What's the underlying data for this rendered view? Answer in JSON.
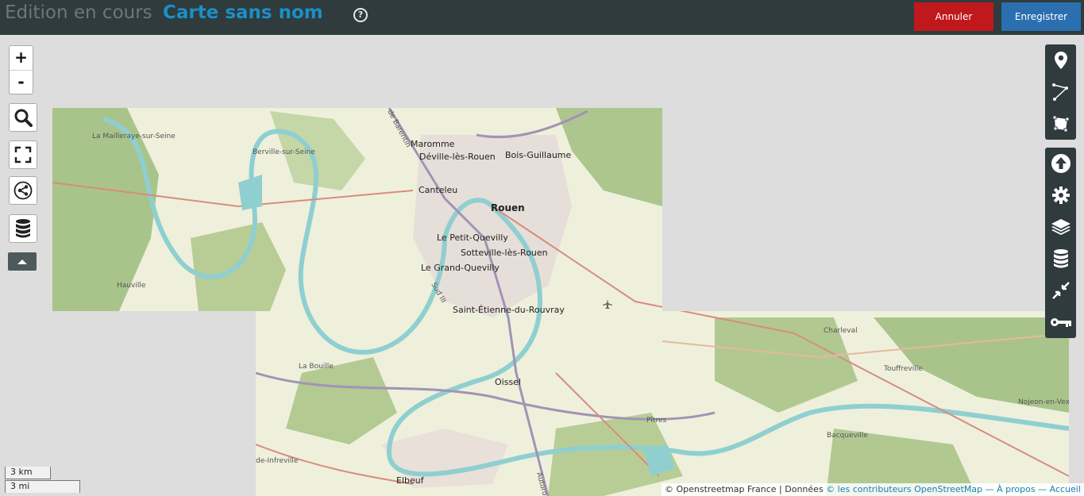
{
  "header": {
    "title_prefix": "Edition en cours",
    "title_name": "Carte sans nom",
    "help_symbol": "?",
    "cancel_label": "Annuler",
    "save_label": "Enregistrer",
    "colors": {
      "bar": "#2f3b3d",
      "title_name": "#1b8fc7",
      "cancel": "#c0181c",
      "save": "#2b6fb1"
    }
  },
  "left_controls": {
    "zoom_in": "+",
    "zoom_out": "-",
    "icons": [
      "search-icon",
      "fullscreen-icon",
      "share-icon",
      "data-layers-icon",
      "collapse-up-icon"
    ]
  },
  "right_toolbar": {
    "draw": [
      "marker-icon",
      "polyline-icon",
      "polygon-icon"
    ],
    "edit": [
      "upload-icon",
      "gear-icon",
      "layers-icon",
      "database-icon",
      "compress-icon",
      "key-icon"
    ]
  },
  "scale": {
    "km": "3 km",
    "mi": "3 mi"
  },
  "attribution": {
    "prefix": "© Openstreetmap France | Données ",
    "contributors": "© les contributeurs OpenStreetMap",
    "about": "— À propos",
    "home": "— Accueil"
  },
  "map_labels": {
    "rouen": "Rouen",
    "maromme": "Maromme",
    "deville": "Déville-lès-Rouen",
    "bois_guillaume": "Bois-Guillaume",
    "canteleu": "Canteleu",
    "petit_quevilly": "Le Petit-Quevilly",
    "sotteville": "Sotteville-lès-Rouen",
    "grand_quevilly": "Le Grand-Quevilly",
    "saint_etienne": "Saint-Étienne-du-Rouvray",
    "mailleraye": "La Mailleraye-sur-Seine",
    "berville": "Berville-sur-Seine",
    "hauville": "Hauville",
    "la_bouille": "La Bouille",
    "oissel": "Oissel",
    "elbeuf": "Elbeuf",
    "pitres": "Pîtres",
    "bacqueville": "Bacqueville",
    "charleval": "Charleval",
    "touffreville": "Touffreville",
    "nojeon": "Nojeon-en-Vex",
    "infreville": "de-Infreville",
    "barentin": "de Barentin",
    "sud3": "Sud III",
    "autoroute": "Autoro"
  }
}
